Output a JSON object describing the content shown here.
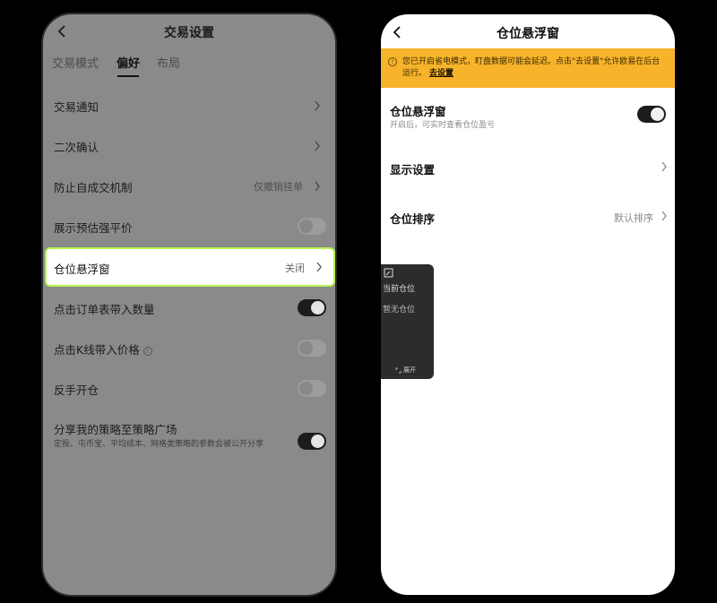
{
  "left_screen": {
    "title": "交易设置",
    "tabs": [
      {
        "label": "交易模式",
        "active": false
      },
      {
        "label": "偏好",
        "active": true
      },
      {
        "label": "布局",
        "active": false
      }
    ],
    "rows": [
      {
        "label": "交易通知",
        "type": "chevron"
      },
      {
        "label": "二次确认",
        "type": "chevron"
      },
      {
        "label": "防止自成交机制",
        "value": "仅撤销挂单",
        "type": "chevron"
      },
      {
        "label": "展示预估强平价",
        "type": "toggle",
        "on": false
      },
      {
        "label": "仓位悬浮窗",
        "value": "关闭",
        "type": "chevron",
        "highlighted": true
      },
      {
        "label": "点击订单表带入数量",
        "type": "toggle",
        "on": true
      },
      {
        "label": "点击K线带入价格",
        "type": "toggle",
        "on": false,
        "info_icon": true
      },
      {
        "label": "反手开仓",
        "type": "toggle",
        "on": false
      },
      {
        "label": "分享我的策略至策略广场",
        "sub": "定投、屯币宝、平均成本、网格类策略的参数会被公开分享",
        "type": "toggle",
        "on": true
      }
    ]
  },
  "right_screen": {
    "title": "仓位悬浮窗",
    "banner": {
      "text": "您已开启省电模式，盯盘数据可能会延迟。点击\"去设置\"允许欧易在后台运行。",
      "link": "去设置"
    },
    "rows": [
      {
        "label": "仓位悬浮窗",
        "sub": "开启后，可实时查看仓位盈亏",
        "type": "toggle",
        "on": true
      },
      {
        "label": "显示设置",
        "type": "chevron"
      },
      {
        "label": "仓位排序",
        "value": "默认排序",
        "type": "chevron"
      }
    ],
    "float_widget": {
      "title": "当前仓位",
      "empty": "暂无仓位",
      "expand_label": "展开"
    }
  },
  "colors": {
    "highlight_border": "#b7f34b",
    "banner_bg": "#f7b32b",
    "toggle_on": "#1c1c1c"
  }
}
